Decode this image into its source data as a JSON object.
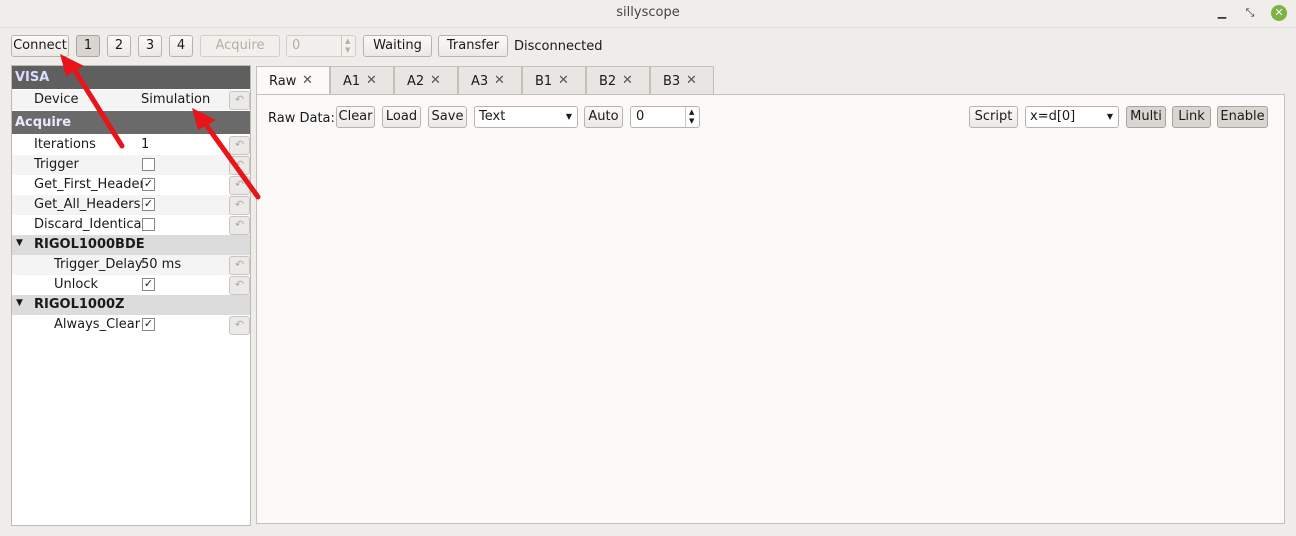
{
  "window": {
    "title": "sillyscope",
    "minimize_icon": "minimize-icon",
    "maximize_icon": "maximize-icon",
    "close_icon": "close-icon"
  },
  "toolbar": {
    "connect": "Connect",
    "channels": [
      "1",
      "2",
      "3",
      "4"
    ],
    "acquire": "Acquire",
    "count_value": "0",
    "waiting": "Waiting",
    "transfer": "Transfer",
    "status": "Disconnected"
  },
  "sidebar": {
    "visa_header": "VISA",
    "device_label": "Device",
    "device_value": "Simulation",
    "acquire_header": "Acquire",
    "iterations_label": "Iterations",
    "iterations_value": "1",
    "trigger_label": "Trigger",
    "get_first_header_label": "Get_First_Header",
    "get_all_headers_label": "Get_All_Headers",
    "discard_identical_label": "Discard_Identical",
    "rigol_bde_group": "RIGOL1000BDE",
    "trigger_delay_label": "Trigger_Delay",
    "trigger_delay_value": "50 ms",
    "unlock_label": "Unlock",
    "rigol_z_group": "RIGOL1000Z",
    "always_clear_label": "Always_Clear",
    "checks": {
      "trigger": false,
      "get_first_header": true,
      "get_all_headers": true,
      "discard_identical": false,
      "unlock": true,
      "always_clear": true
    }
  },
  "tabs": [
    "Raw",
    "A1",
    "A2",
    "A3",
    "B1",
    "B2",
    "B3"
  ],
  "raw": {
    "label": "Raw Data:",
    "clear": "Clear",
    "load": "Load",
    "save": "Save",
    "format": "Text",
    "auto": "Auto",
    "auto_value": "0",
    "script": "Script",
    "expr": "x=d[0]",
    "multi": "Multi",
    "link": "Link",
    "enable": "Enable"
  },
  "annotation_color": "#e8141a"
}
